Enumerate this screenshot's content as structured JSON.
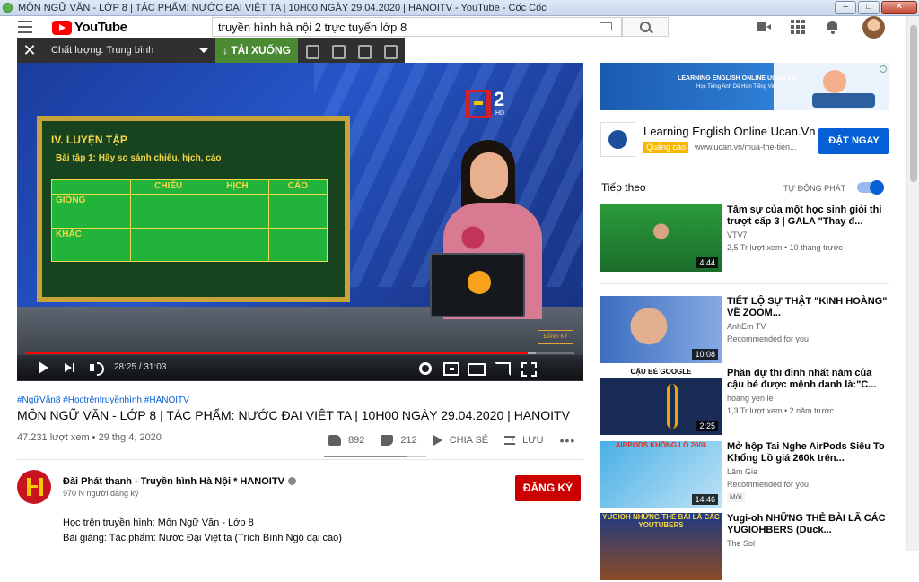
{
  "window": {
    "title": "MÔN NGỮ VĂN - LỚP 8 | TÁC PHẨM: NƯỚC ĐẠI VIỆT TA | 10H00 NGÀY 29.04.2020 | HANOITV - YouTube - Cốc Cốc",
    "buttons": [
      "–",
      "□",
      "✕"
    ]
  },
  "header": {
    "logo_text": "YouTube",
    "search_value": "truyền hình hà nội 2 trực tuyến lớp 8"
  },
  "downloader": {
    "close": "✕",
    "quality": "Chất lượng: Trung bình",
    "download": "↓ TẢI XUỐNG"
  },
  "player": {
    "board_title": "IV. LUYỆN TẬP",
    "board_task": "Bài tập 1: Hãy so sánh chiếu, hịch, cáo",
    "table_header": [
      "",
      "CHIẾU",
      "HỊCH",
      "CÁO"
    ],
    "table_rows": [
      "GIỐNG",
      "KHÁC"
    ],
    "channel_logo_number": "2",
    "channel_logo_hd": "HD",
    "watermark": "ĐĂNG KÝ",
    "time": "28:25 / 31:03",
    "progress_played": 0.915,
    "progress_loaded": 0.93
  },
  "video": {
    "hashtags": "#NgữVăn8 #Họctrêntruyềnhình #HANOITV",
    "title": "MÔN NGỮ VĂN - LỚP 8 | TÁC PHẨM: NƯỚC ĐẠI VIỆT TA | 10H00 NGÀY 29.04.2020 | HANOITV",
    "views": "47.231 lượt xem • 29 thg 4, 2020",
    "likes": "892",
    "dislikes": "212",
    "share": "CHIA SẺ",
    "save": "LƯU",
    "more": "•••",
    "like_ratio": 0.81
  },
  "channel": {
    "name": "Đài Phát thanh - Truyền hình Hà Nội * HANOITV",
    "subs": "970 N người đăng ký",
    "subscribe": "ĐĂNG KÝ",
    "desc": [
      "Học trên truyền hình: Môn Ngữ Văn - Lớp 8",
      "Bài giảng: Tác phẩm: Nước Đại Việt ta (Trích Bình Ngô đại cáo)"
    ]
  },
  "ad": {
    "banner_line1": "LEARNING ENGLISH ONLINE UCAN.VN",
    "banner_line2": "Học Tiếng Anh Dễ Hơn Tiếng Việt",
    "name": "Learning English Online Ucan.Vn",
    "badge": "Quảng cáo",
    "url": "www.ucan.vn/mua-the-tien...",
    "cta": "ĐẶT NGAY"
  },
  "sidebar": {
    "up_next": "Tiếp theo",
    "autoplay": "TỰ ĐỘNG PHÁT",
    "autoplay_on": true,
    "items": [
      {
        "title": "Tâm sự của một học sinh giỏi thi trượt cấp 3 | GALA \"Thay đ...",
        "channel": "VTV7",
        "meta": "2,5 Tr lượt xem • 10 tháng trước",
        "duration": "4:44",
        "badge": ""
      },
      {
        "title": "TIẾT LỘ SỰ THẬT \"KINH HOÀNG\" VỀ ZOOM...",
        "channel": "AnhEm TV",
        "meta": "Recommended for you",
        "duration": "10:08",
        "badge": ""
      },
      {
        "title": "Phần dự thi đỉnh nhất năm của cậu bé được mệnh danh là:\"C...",
        "channel": "hoang yen le",
        "meta": "1,3 Tr lượt xem • 2 năm trước",
        "duration": "2:25",
        "badge": "",
        "thumb_caption": "CẬU BÉ GOOGLE"
      },
      {
        "title": "Mở hộp Tai Nghe AirPods Siêu To Khổng Lồ giá 260k trên...",
        "channel": "Lâm Gia",
        "meta": "Recommended for you",
        "duration": "14:46",
        "badge": "Mới",
        "thumb_caption": "AIRPODS KHỔNG LỒ 260k"
      },
      {
        "title": "Yugi-oh NHỮNG THẺ BÀI LÃ CÁC YUGIOHBERS (Duck...",
        "channel": "The Sol",
        "meta": "",
        "duration": "",
        "badge": "",
        "thumb_caption": "YUGIOH NHỮNG THẺ BÀI LÃ CÁC YOUTUBERS"
      }
    ]
  }
}
